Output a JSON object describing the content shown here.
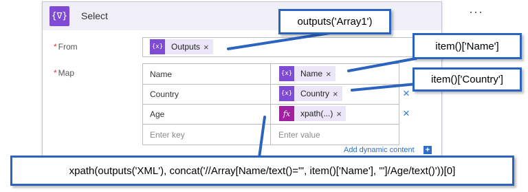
{
  "action": {
    "icon": "{∇}",
    "title": "Select",
    "more_glyph": "···"
  },
  "from": {
    "label": "From",
    "required_mark": "*",
    "token": {
      "icon": "{x}",
      "label": "Outputs",
      "remove": "×"
    }
  },
  "map": {
    "label": "Map",
    "required_mark": "*",
    "rows": [
      {
        "key": "Name",
        "token": {
          "icon": "{x}",
          "label": "Name",
          "remove": "×"
        }
      },
      {
        "key": "Country",
        "token": {
          "icon": "{x}",
          "label": "Country",
          "remove": "×"
        }
      },
      {
        "key": "Age",
        "token": {
          "icon": "fx",
          "label": "xpath(...)",
          "remove": "×"
        }
      }
    ],
    "key_placeholder": "Enter key",
    "value_placeholder": "Enter value",
    "delete_glyph": "×"
  },
  "add_dynamic": {
    "label": "Add dynamic content",
    "plus": "+"
  },
  "callouts": {
    "array1": "outputs('Array1')",
    "name": "item()['Name']",
    "country": "item()['Country']",
    "xpath": "xpath(outputs('XML'), concat('//Array[Name/text()=\"', item()['Name'], '\"]/Age/text()'))[0]"
  },
  "colors": {
    "accent_purple": "#7f4ad4",
    "fx_purple": "#a020a0",
    "callout_blue": "#2b64c0",
    "link_blue": "#2f6fc7"
  }
}
